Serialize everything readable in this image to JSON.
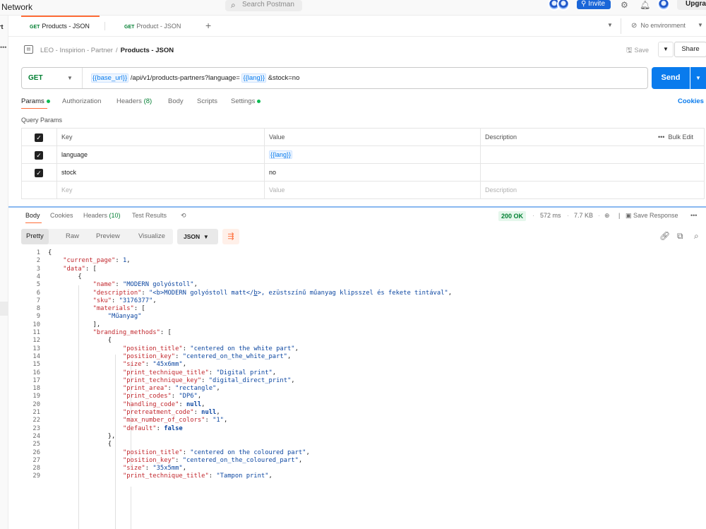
{
  "app": {
    "workspace_name": "l Network",
    "search_placeholder": "Search Postman",
    "invite_label": "Invite",
    "upgrade_label": "Upgrad",
    "accent_color": "#ff6c37",
    "primary_color": "#097bed"
  },
  "rail": {
    "top_label": "rt",
    "dots": "•••"
  },
  "tabs": [
    {
      "method": "GET",
      "label": "Products - JSON",
      "active": true
    },
    {
      "method": "GET",
      "label": "Product - JSON",
      "active": false
    }
  ],
  "environment": {
    "label": "No environment"
  },
  "breadcrumb": {
    "collection": "LEO - Inspirion - Partner",
    "separator": "/",
    "request": "Products - JSON",
    "save_label": "Save",
    "share_label": "Share"
  },
  "request": {
    "method": "GET",
    "url_var": "{{base_url}}",
    "url_mid": " /api/v1/products-partners?language= ",
    "url_var2": "{{lang}}",
    "url_end": " &stock=no",
    "send_label": "Send"
  },
  "request_tabs": {
    "params": "Params",
    "authorization": "Authorization",
    "headers": "Headers",
    "headers_count": "(8)",
    "body": "Body",
    "scripts": "Scripts",
    "settings": "Settings",
    "cookies": "Cookies"
  },
  "query_params": {
    "title": "Query Params",
    "col_key": "Key",
    "col_value": "Value",
    "col_description": "Description",
    "bulk_edit": "Bulk Edit",
    "rows": [
      {
        "key": "language",
        "value": "{{lang}}",
        "checked": true
      },
      {
        "key": "stock",
        "value": "no",
        "checked": true
      }
    ],
    "placeholder_key": "Key",
    "placeholder_value": "Value",
    "placeholder_description": "Description"
  },
  "response": {
    "tabs": {
      "body": "Body",
      "cookies": "Cookies",
      "headers": "Headers",
      "headers_count": "(10)",
      "test_results": "Test Results"
    },
    "status": "200 OK",
    "time": "572 ms",
    "size": "7.7 KB",
    "save_response": "Save Response",
    "views": [
      "Pretty",
      "Raw",
      "Preview",
      "Visualize"
    ],
    "format": "JSON"
  },
  "code_lines": [
    "{",
    "    \"current_page\": 1,",
    "    \"data\": [",
    "        {",
    "            \"name\": \"MODERN golyóstoll\",",
    "            \"description\": \"<b>MODERN golyóstoll matt</b>, ezüstszínű műanyag klipsszel és fekete tintával\",",
    "            \"sku\": \"3176377\",",
    "            \"materials\": [",
    "                \"Műanyag\"",
    "            ],",
    "            \"branding_methods\": [",
    "                {",
    "                    \"position_title\": \"centered on the white part\",",
    "                    \"position_key\": \"centered_on_the_white_part\",",
    "                    \"size\": \"45x6mm\",",
    "                    \"print_technique_title\": \"Digital print\",",
    "                    \"print_technique_key\": \"digital_direct_print\",",
    "                    \"print_area\": \"rectangle\",",
    "                    \"print_codes\": \"DP6\",",
    "                    \"handling_code\": null,",
    "                    \"pretreatment_code\": null,",
    "                    \"max_number_of_colors\": \"1\",",
    "                    \"default\": false",
    "                },",
    "                {",
    "                    \"position_title\": \"centered on the coloured part\",",
    "                    \"position_key\": \"centered_on_the_coloured_part\",",
    "                    \"size\": \"35x5mm\",",
    "                    \"print_technique_title\": \"Tampon print\","
  ]
}
